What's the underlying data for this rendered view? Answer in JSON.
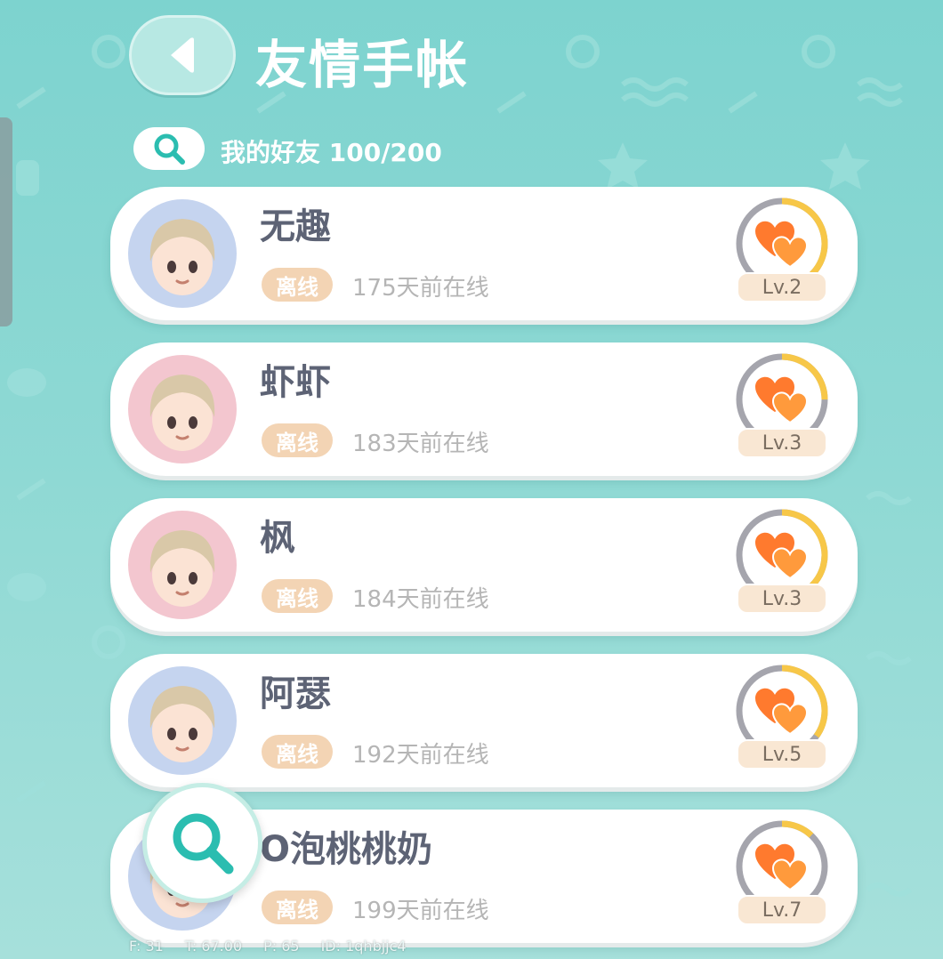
{
  "header": {
    "title": "友情手帐",
    "friend_count_label": "我的好友 100/200"
  },
  "friends": [
    {
      "name": "无趣",
      "status": "离线",
      "last_online": "175天前在线",
      "level": "Lv.2",
      "progress": 0.5,
      "avatar_bg": "#c5d4ef"
    },
    {
      "name": "虾虾",
      "status": "离线",
      "last_online": "183天前在线",
      "level": "Lv.3",
      "progress": 0.25,
      "avatar_bg": "#f3c6cf"
    },
    {
      "name": "枫",
      "status": "离线",
      "last_online": "184天前在线",
      "level": "Lv.3",
      "progress": 0.6,
      "avatar_bg": "#f3c6cf"
    },
    {
      "name": "阿瑟",
      "status": "离线",
      "last_online": "192天前在线",
      "level": "Lv.5",
      "progress": 0.35,
      "avatar_bg": "#c5d4ef"
    },
    {
      "name": "O泡桃桃奶",
      "status": "离线",
      "last_online": "199天前在线",
      "level": "Lv.7",
      "progress": 0.12,
      "avatar_bg": "#c5d4ef"
    }
  ],
  "debug": {
    "f": "F: 31",
    "t": "T: 67.00",
    "p": "P: 65",
    "id": "ID: 1qhbjjc4"
  },
  "icons": {
    "back": "chevron-left-icon",
    "search": "search-icon",
    "level": "heart-icon"
  },
  "colors": {
    "background": "#7dd3cf",
    "accent": "#2bbdb0",
    "status_badge": "#f3d4b4",
    "progress": "#f7c748",
    "heart": "#ff7a2e"
  }
}
